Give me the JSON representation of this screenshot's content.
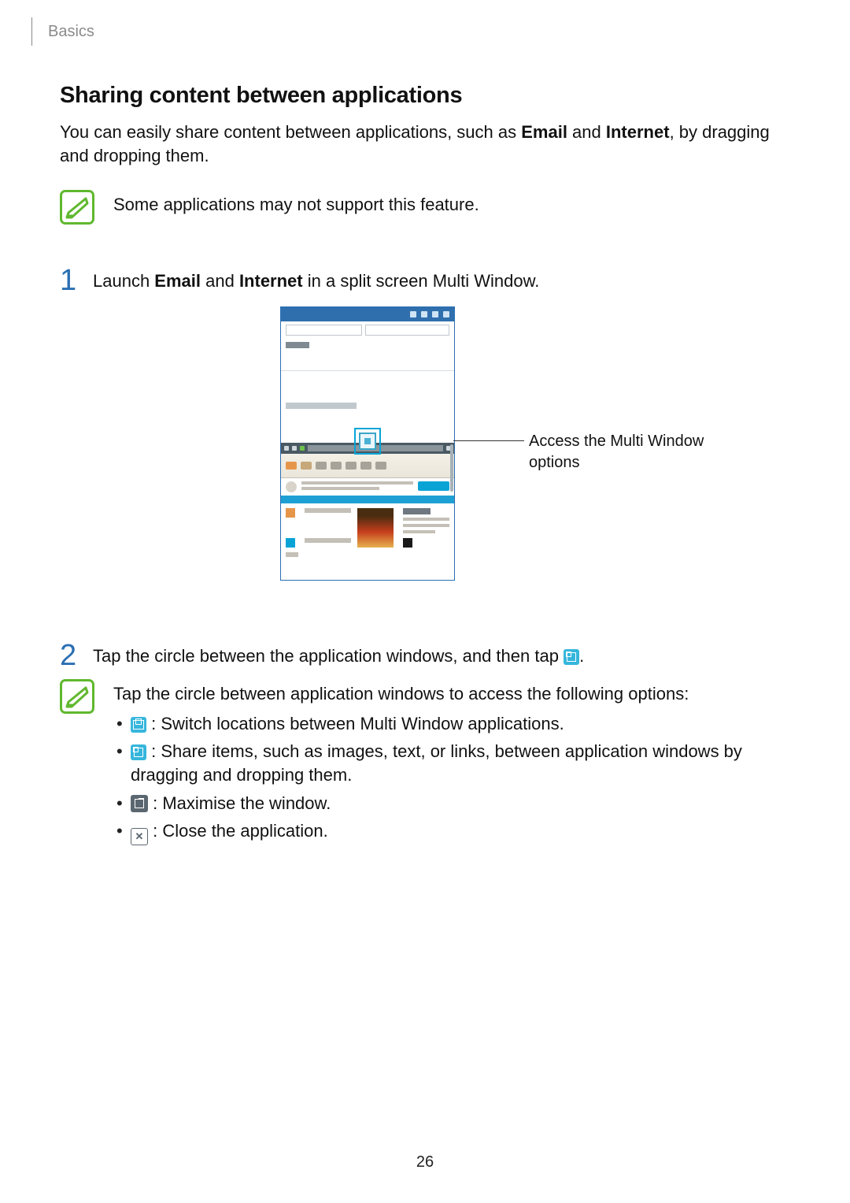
{
  "header": {
    "section": "Basics"
  },
  "title": "Sharing content between applications",
  "intro": {
    "pre": "You can easily share content between applications, such as ",
    "bold1": "Email",
    "mid": " and ",
    "bold2": "Internet",
    "post": ", by dragging and dropping them."
  },
  "note1": "Some applications may not support this feature.",
  "step1": {
    "num": "1",
    "pre": "Launch ",
    "b1": "Email",
    "mid": " and ",
    "b2": "Internet",
    "post": " in a split screen Multi Window."
  },
  "callout": "Access the Multi Window options",
  "step2": {
    "num": "2",
    "pre": "Tap the circle between the application windows, and then tap ",
    "post": "."
  },
  "note2": {
    "lead": "Tap the circle between application windows to access the following options:",
    "items": {
      "switch": " : Switch locations between Multi Window applications.",
      "share": " : Share items, such as images, text, or links, between application windows by dragging and dropping them.",
      "max": " : Maximise the window.",
      "close": " : Close the application."
    }
  },
  "pageNumber": "26"
}
